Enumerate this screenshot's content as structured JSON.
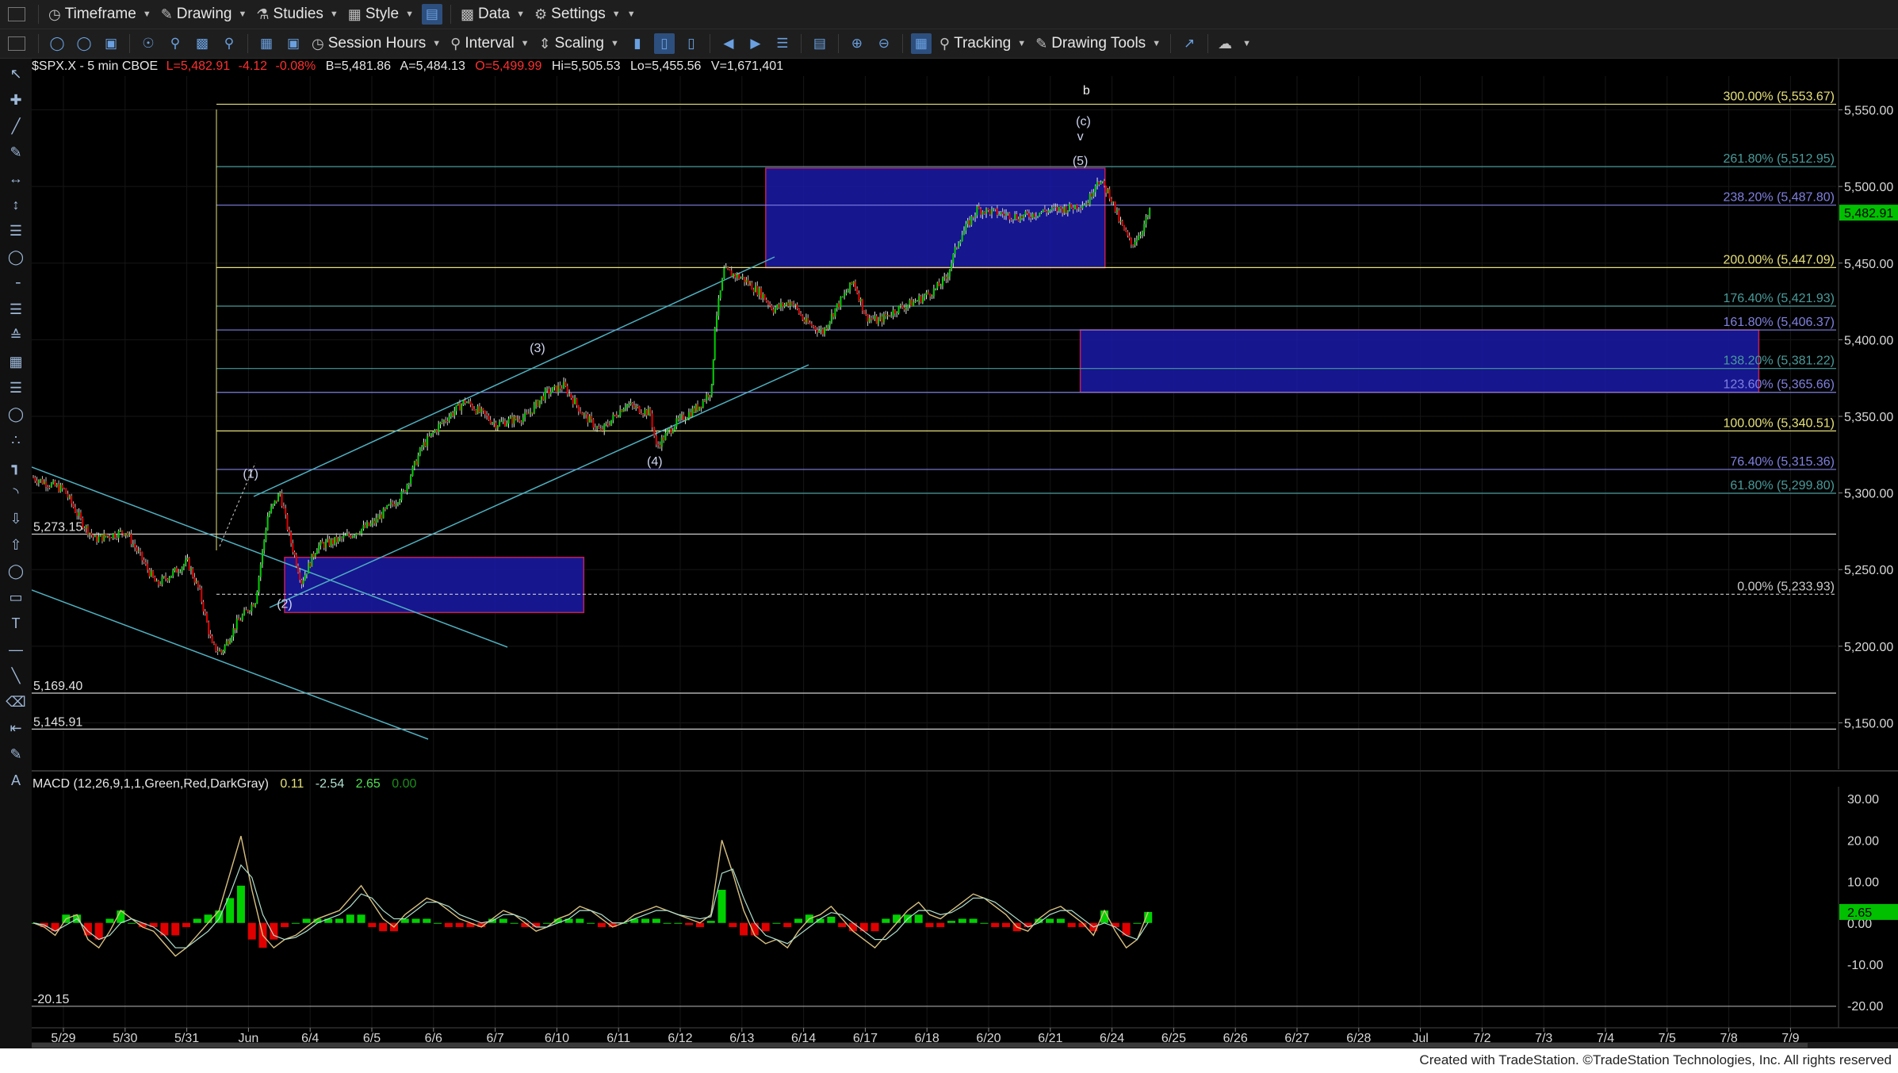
{
  "toolbar_top": {
    "timeframe": "Timeframe",
    "drawing": "Drawing",
    "studies": "Studies",
    "style": "Style",
    "data": "Data",
    "settings": "Settings"
  },
  "toolbar_bottom": {
    "session_hours": "Session Hours",
    "interval": "Interval",
    "scaling": "Scaling",
    "tracking": "Tracking",
    "drawing_tools": "Drawing Tools"
  },
  "symbol_header": {
    "symbol": "$SPX.X - 5 min  CBOE",
    "last": "L=5,482.91",
    "change": "-4.12",
    "change_pct": "-0.08%",
    "bid": "B=5,481.86",
    "ask": "A=5,484.13",
    "open": "O=5,499.99",
    "high": "Hi=5,505.53",
    "low": "Lo=5,455.56",
    "volume": "V=1,671,401"
  },
  "macd_header": {
    "name": "MACD (12,26,9,1,1,Green,Red,DarkGray)",
    "v1": "0.11",
    "v2": "-2.54",
    "v3": "2.65",
    "v4": "0.00"
  },
  "footer": "Created with TradeStation. ©TradeStation Technologies, Inc. All rights reserved",
  "colors": {
    "up": "#00d000",
    "down": "#e00000",
    "macd": "#d8c080",
    "signal": "#b0e0d0",
    "zone_fill": "#1a1aa8",
    "zone_border": "#c0205a",
    "channel": "#4fb0c0",
    "price_box": "#00c000"
  },
  "chart_data": {
    "type": "line",
    "title": "$SPX.X - 5 min",
    "price_axis_ticks": [
      "5,550.00",
      "5,500.00",
      "5,450.00",
      "5,400.00",
      "5,350.00",
      "5,300.00",
      "5,250.00",
      "5,200.00",
      "5,150.00"
    ],
    "price_axis_values": [
      5550,
      5500,
      5450,
      5400,
      5350,
      5300,
      5250,
      5200,
      5150
    ],
    "ylim": [
      5128,
      5572
    ],
    "last_price_label": "5,482.91",
    "last_price": 5482.91,
    "date_axis": [
      "5/29",
      "5/30",
      "5/31",
      "Jun",
      "6/4",
      "6/5",
      "6/6",
      "6/7",
      "6/10",
      "6/11",
      "6/12",
      "6/13",
      "6/14",
      "6/17",
      "6/18",
      "6/20",
      "6/21",
      "6/24",
      "6/25",
      "6/26",
      "6/27",
      "6/28",
      "Jul",
      "7/2",
      "7/3",
      "7/4",
      "7/5",
      "7/8",
      "7/9"
    ],
    "price_path": [
      [
        0,
        5310
      ],
      [
        0.5,
        5302
      ],
      [
        0.8,
        5280
      ],
      [
        1.0,
        5270
      ],
      [
        1.5,
        5275
      ],
      [
        2.0,
        5240
      ],
      [
        2.5,
        5255
      ],
      [
        2.7,
        5235
      ],
      [
        2.9,
        5200
      ],
      [
        3.05,
        5196
      ],
      [
        3.3,
        5215
      ],
      [
        3.6,
        5230
      ],
      [
        3.8,
        5285
      ],
      [
        4.0,
        5300
      ],
      [
        4.15,
        5272
      ],
      [
        4.35,
        5242
      ],
      [
        4.6,
        5265
      ],
      [
        5.0,
        5270
      ],
      [
        5.5,
        5280
      ],
      [
        6.0,
        5300
      ],
      [
        6.3,
        5330
      ],
      [
        6.6,
        5345
      ],
      [
        7.0,
        5360
      ],
      [
        7.5,
        5345
      ],
      [
        8.0,
        5350
      ],
      [
        8.3,
        5365
      ],
      [
        8.6,
        5370
      ],
      [
        8.9,
        5352
      ],
      [
        9.2,
        5340
      ],
      [
        9.6,
        5358
      ],
      [
        10.0,
        5352
      ],
      [
        10.1,
        5330
      ],
      [
        10.4,
        5345
      ],
      [
        10.8,
        5357
      ],
      [
        11.0,
        5368
      ],
      [
        11.05,
        5410
      ],
      [
        11.2,
        5445
      ],
      [
        11.5,
        5440
      ],
      [
        11.8,
        5430
      ],
      [
        12.0,
        5420
      ],
      [
        12.3,
        5425
      ],
      [
        12.5,
        5412
      ],
      [
        12.8,
        5405
      ],
      [
        13.0,
        5420
      ],
      [
        13.3,
        5438
      ],
      [
        13.5,
        5415
      ],
      [
        13.7,
        5412
      ],
      [
        14.0,
        5420
      ],
      [
        14.3,
        5425
      ],
      [
        14.6,
        5432
      ],
      [
        14.8,
        5440
      ],
      [
        15.0,
        5465
      ],
      [
        15.3,
        5485
      ],
      [
        15.6,
        5483
      ],
      [
        16.0,
        5480
      ],
      [
        16.4,
        5484
      ],
      [
        16.8,
        5486
      ],
      [
        17.1,
        5490
      ],
      [
        17.25,
        5505
      ],
      [
        17.45,
        5495
      ],
      [
        17.6,
        5478
      ],
      [
        17.8,
        5462
      ],
      [
        17.95,
        5470
      ],
      [
        18.1,
        5482.91
      ]
    ],
    "fib_levels": [
      {
        "label": "300.00% (5,553.67)",
        "value": 5553.67,
        "color": "#e6e07a"
      },
      {
        "label": "261.80% (5,512.95)",
        "value": 5512.95,
        "color": "#4a9a9a"
      },
      {
        "label": "238.20% (5,487.80)",
        "value": 5487.8,
        "color": "#8080e0"
      },
      {
        "label": "200.00% (5,447.09)",
        "value": 5447.09,
        "color": "#e6e07a"
      },
      {
        "label": "176.40% (5,421.93)",
        "value": 5421.93,
        "color": "#4a9a9a"
      },
      {
        "label": "161.80% (5,406.37)",
        "value": 5406.37,
        "color": "#8080e0"
      },
      {
        "label": "138.20% (5,381.22)",
        "value": 5381.22,
        "color": "#4a9a9a"
      },
      {
        "label": "123.60% (5,365.66)",
        "value": 5365.66,
        "color": "#8080e0"
      },
      {
        "label": "100.00% (5,340.51)",
        "value": 5340.51,
        "color": "#e6e07a"
      },
      {
        "label": "76.40% (5,315.36)",
        "value": 5315.36,
        "color": "#8080e0"
      },
      {
        "label": "61.80% (5,299.80)",
        "value": 5299.8,
        "color": "#4a9a9a"
      },
      {
        "label": "0.00% (5,233.93)",
        "value": 5233.93,
        "color": "#cccccc"
      }
    ],
    "horizontal_lines": [
      {
        "label": "5,273.15",
        "value": 5273.15
      },
      {
        "label": "5,169.40",
        "value": 5169.4
      },
      {
        "label": "5,145.91",
        "value": 5145.91
      }
    ],
    "wave_labels": [
      {
        "text": "(1)",
        "x": 3.55,
        "y": 5310
      },
      {
        "text": "(2)",
        "x": 4.1,
        "y": 5225
      },
      {
        "text": "(3)",
        "x": 8.2,
        "y": 5392
      },
      {
        "text": "(4)",
        "x": 10.1,
        "y": 5318
      },
      {
        "text": "(5)",
        "x": 17.0,
        "y": 5514
      },
      {
        "text": "(c)",
        "x": 17.05,
        "y": 5540
      },
      {
        "text": "v",
        "x": 17.0,
        "y": 5530
      },
      {
        "text": "b",
        "x": 17.1,
        "y": 5560
      }
    ],
    "zones": [
      {
        "x1": 11.9,
        "x2": 17.4,
        "y1": 5447,
        "y2": 5512
      },
      {
        "x1": 17.0,
        "x2": 28.0,
        "y1": 5365.7,
        "y2": 5406.4
      },
      {
        "x1": 4.1,
        "x2": 8.95,
        "y1": 5222,
        "y2": 5258
      }
    ],
    "macd_axis_ticks": [
      "30.00",
      "20.00",
      "10.00",
      "0.00",
      "-10.00",
      "-20.00"
    ],
    "macd_axis_values": [
      30,
      20,
      10,
      0,
      -10,
      -20
    ],
    "macd_ylim": [
      -24,
      31
    ],
    "macd_low_label": "-20.15",
    "macd_low_value": -20.15,
    "macd_current_label": "2.65",
    "macd_current": 2.65,
    "macd_series": [
      0,
      -1,
      -3,
      1,
      2,
      -4,
      -6,
      -2,
      3,
      1,
      -1,
      -2,
      -5,
      -8,
      -6,
      -3,
      0,
      3,
      12,
      21,
      8,
      -3,
      -6,
      -4,
      -3,
      -1,
      1,
      2,
      3,
      6,
      9,
      5,
      1,
      -1,
      2,
      4,
      6,
      5,
      3,
      1,
      0,
      -1,
      1,
      3,
      2,
      0,
      -2,
      -1,
      1,
      2,
      4,
      3,
      1,
      -1,
      0,
      2,
      3,
      4,
      3,
      2,
      1,
      0,
      2,
      20,
      12,
      3,
      -3,
      -5,
      -4,
      -6,
      -2,
      1,
      2,
      4,
      1,
      -2,
      -4,
      -6,
      -3,
      0,
      3,
      5,
      2,
      1,
      3,
      5,
      7,
      6,
      4,
      2,
      -1,
      -2,
      1,
      3,
      4,
      2,
      0,
      -3,
      3,
      -2,
      -6,
      -4,
      2.65
    ],
    "signal_series": [
      0,
      -0.5,
      -2,
      -0.5,
      1,
      -2,
      -4,
      -3,
      0,
      1,
      0,
      -1,
      -3,
      -6,
      -6,
      -4,
      -2,
      1,
      7,
      14,
      11,
      2,
      -3,
      -4,
      -3.5,
      -2,
      0,
      1,
      2,
      4,
      7,
      6,
      3,
      1,
      1,
      3,
      5,
      5,
      4,
      2,
      1,
      0,
      0.5,
      2,
      2,
      1,
      -1,
      -1,
      0,
      1,
      3,
      3,
      2,
      0,
      0,
      1,
      2,
      3,
      3,
      2,
      1.5,
      1,
      1.5,
      12,
      13,
      6,
      0,
      -3,
      -4,
      -5,
      -3,
      -1,
      1,
      2.5,
      2,
      0,
      -2,
      -4,
      -4,
      -2,
      1,
      3,
      3,
      2,
      2.5,
      4,
      6,
      6,
      5,
      3,
      1,
      -1,
      0,
      2,
      3,
      3,
      1,
      -1,
      0,
      -1,
      -3,
      -4,
      0.11
    ],
    "histogram": [
      0,
      -1,
      -2,
      2,
      2,
      -3,
      -4,
      1,
      3,
      0,
      -1,
      -1,
      -3,
      -3,
      -1,
      1,
      2,
      3,
      6,
      9,
      -4,
      -6,
      -4,
      -1,
      0,
      1,
      1,
      1,
      1,
      2,
      2,
      -1,
      -2,
      -2,
      1,
      1,
      1,
      0,
      -1,
      -1,
      -1,
      -1,
      1,
      1,
      0,
      -1,
      -1,
      0,
      1,
      1,
      1,
      0,
      -1,
      -1,
      0,
      1,
      1,
      1,
      0,
      0,
      -0.5,
      -1,
      0.5,
      8,
      -1,
      -3,
      -3,
      -2,
      0,
      -1,
      1,
      2,
      1,
      1.5,
      -1,
      -2,
      -2,
      -2,
      1,
      2,
      2,
      2,
      -1,
      -1,
      0.5,
      1,
      1,
      0,
      -1,
      -1,
      -2,
      -1,
      1,
      1,
      1,
      -1,
      -1,
      -2,
      3,
      -1,
      -3,
      0,
      2.65
    ]
  }
}
